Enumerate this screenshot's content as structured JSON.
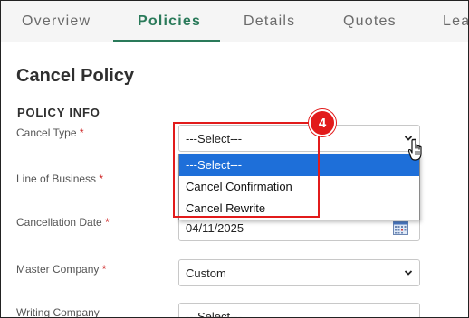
{
  "tabs": [
    {
      "label": "Overview",
      "active": false
    },
    {
      "label": "Policies",
      "active": true
    },
    {
      "label": "Details",
      "active": false
    },
    {
      "label": "Quotes",
      "active": false
    },
    {
      "label": "Lea",
      "active": false
    }
  ],
  "page": {
    "title": "Cancel Policy",
    "section": "POLICY INFO"
  },
  "form": {
    "cancel_type": {
      "label": "Cancel Type",
      "required": "*",
      "value": "---Select---"
    },
    "line_of_business": {
      "label": "Line of Business",
      "required": "*"
    },
    "cancellation_date": {
      "label": "Cancellation Date",
      "required": "*",
      "value": "04/11/2025"
    },
    "master_company": {
      "label": "Master Company",
      "required": "*",
      "value": "Custom"
    },
    "writing_company": {
      "label": "Writing Company",
      "value": "---Select---"
    }
  },
  "dropdown": {
    "options": [
      "---Select---",
      "Cancel Confirmation",
      "Cancel Rewrite"
    ],
    "selected": "---Select---"
  },
  "annotation": {
    "step": "4"
  },
  "colors": {
    "accent": "#2a7a5a",
    "annotation": "#e21b1b",
    "highlight": "#1e6fd9"
  },
  "icons": [
    "chevron-down-icon",
    "calendar-icon",
    "hand-cursor-icon"
  ]
}
